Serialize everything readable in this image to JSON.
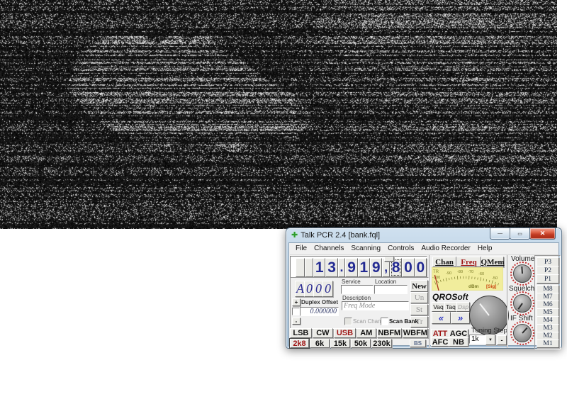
{
  "static_area": {
    "label": "TV static noise with Australia silhouette"
  },
  "win": {
    "title": "Talk PCR 2.4 [bank.fql]",
    "menu": [
      "File",
      "Channels",
      "Scanning",
      "Controls",
      "Audio Recorder",
      "Help"
    ],
    "freq_cells": [
      "",
      "",
      "1",
      "3",
      ".",
      "9",
      "1",
      "9",
      ",",
      "8",
      "0",
      "0"
    ],
    "chan_cells": [
      "A",
      "0",
      "0",
      "0"
    ],
    "service_label": "Service",
    "service_value": "",
    "location_label": "Location",
    "location_value": "",
    "description_label": "Description",
    "description_value": "Freq Mode",
    "btn_new": "New",
    "btn_un": "Un",
    "btn_st": "St",
    "btn_tr": "Tr",
    "duplex_plus": "+",
    "duplex_label": "Duplex Offset",
    "duplex_value": "0.000000",
    "duplex_minus": "-",
    "scan_chan": "Scan Chan",
    "scan_bank": "Scan Bank",
    "modes": [
      "LSB",
      "CW",
      "USB",
      "AM",
      "NBFM",
      "WBFM"
    ],
    "filters": [
      "2k8",
      "6k",
      "15k",
      "50k",
      "230k"
    ],
    "btn_bs": "BS",
    "tabs": [
      "Chan",
      "Freq",
      "QMem"
    ],
    "meter": {
      "corner": "TR",
      "ticks": [
        "-100",
        "-90",
        "-80",
        "-70",
        "-60",
        "-50"
      ],
      "unit": "dBm",
      "sig": "[Sig]"
    },
    "brand": "QROSoft",
    "btn_vaq": "Vaq",
    "btn_taq": "Taq",
    "btn_dsp": "Dsp",
    "arrow_left": "«",
    "arrow_right": "»",
    "btn_att": "ATT",
    "btn_agc": "AGC",
    "btn_afc": "AFC",
    "btn_nb": "NB",
    "tuning_label": "Tuning Step",
    "tuning_step": "1k",
    "tuning_minus": "-",
    "knob_volume": "Volume",
    "knob_squelch": "Squelch",
    "knob_ifshift": "IF Shift",
    "pm": [
      "P3",
      "P2",
      "P1",
      "M8",
      "M7",
      "M6",
      "M5",
      "M4",
      "M3",
      "M2",
      "M1"
    ],
    "icons": {
      "app": "✚",
      "minimize": "—",
      "maximize": "▭",
      "close": "✕",
      "dropdown": "▼"
    }
  }
}
